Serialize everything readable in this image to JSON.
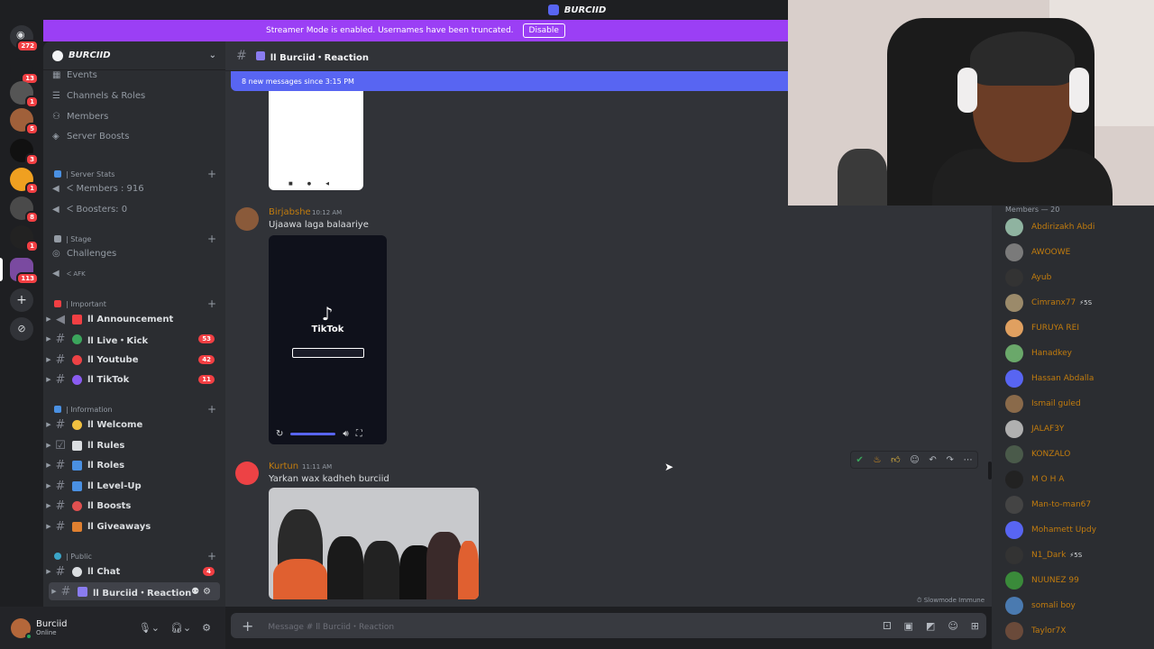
{
  "window": {
    "title": "BURCIID"
  },
  "banner": {
    "text": "Streamer Mode is enabled. Usernames have been truncated.",
    "button": "Disable"
  },
  "rail": {
    "badges": [
      "272",
      "13",
      "1",
      "5",
      "3",
      "1",
      "8",
      "1",
      "113"
    ]
  },
  "server": {
    "name": "BURCIID"
  },
  "sidebar": {
    "top_items": [
      "Events",
      "Channels & Roles",
      "Members",
      "Server Boosts"
    ],
    "cat_stats": "| Server Stats",
    "stat_members": "ᐸ Members : 916",
    "stat_boosters": "ᐸ Boosters: 0",
    "cat_stage": "| Stage",
    "challenges": "Challenges",
    "afk": "ᐸ AFK",
    "cat_important": "| Important",
    "cat_information": "| Information",
    "cat_public": "| Public",
    "channels_important": [
      {
        "name": "ll Announcement",
        "badge": ""
      },
      {
        "name": "ll Live・Kick",
        "badge": "53"
      },
      {
        "name": "ll Youtube",
        "badge": "42"
      },
      {
        "name": "ll TikTok",
        "badge": "11"
      }
    ],
    "channels_information": [
      {
        "name": "ll Welcome"
      },
      {
        "name": "ll Rules"
      },
      {
        "name": "ll Roles"
      },
      {
        "name": "ll Level-Up"
      },
      {
        "name": "ll Boosts"
      },
      {
        "name": "ll Giveaways"
      }
    ],
    "channels_public": [
      {
        "name": "ll Chat",
        "badge": "4"
      },
      {
        "name": "ll Burciid・Reaction",
        "badge": ""
      }
    ]
  },
  "user": {
    "name": "Burciid",
    "status": "Online"
  },
  "chat": {
    "channel_title": "ll Burciid・Reaction",
    "new_messages": "8 new messages since 3:15 PM",
    "messages": [
      {
        "author": "Birjabshe",
        "time": "10:12 AM",
        "text": "Ujaawa laga balaariye"
      },
      {
        "author": "Kurtun",
        "time": "11:11 AM",
        "text": "Yarkan wax kadheh burciid"
      }
    ],
    "tiktok_label": "TikTok",
    "slowmode": "Slowmode Immune",
    "composer_placeholder": "Message # ll Burciid・Reaction"
  },
  "members": {
    "header": "Members — 20",
    "list": [
      {
        "name": "Abdirizakh Abdi",
        "color": "#8fb3a0"
      },
      {
        "name": "AWOOWE",
        "color": "#7a7a7a"
      },
      {
        "name": "Ayub",
        "color": "#333333"
      },
      {
        "name": "Cimranx77",
        "tag": "⚡5S",
        "color": "#9b8a6a"
      },
      {
        "name": "FURUYA REI",
        "color": "#e0a060"
      },
      {
        "name": "Hanadkey",
        "color": "#6aa86a"
      },
      {
        "name": "Hassan Abdalla",
        "color": "#5865f2"
      },
      {
        "name": "Ismail guled",
        "color": "#8a6a4a"
      },
      {
        "name": "JALAF3Y",
        "color": "#b0b0b0"
      },
      {
        "name": "KONZALO",
        "color": "#4a5a4a"
      },
      {
        "name": "M O H A",
        "color": "#222222"
      },
      {
        "name": "Man-to-man67",
        "color": "#444444"
      },
      {
        "name": "Mohamett Updy",
        "color": "#5865f2"
      },
      {
        "name": "N1_Dark",
        "tag": "⚡5S",
        "color": "#333333"
      },
      {
        "name": "NUUNEZ 99",
        "color": "#3a8a3a"
      },
      {
        "name": "somali boy",
        "color": "#4a7ab0"
      },
      {
        "name": "Taylor7X",
        "color": "#6a4a3a"
      }
    ]
  }
}
